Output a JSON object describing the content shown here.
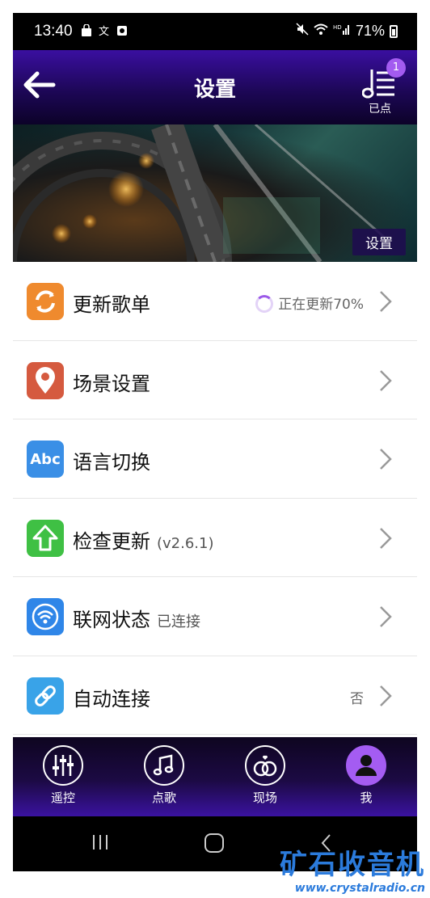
{
  "status_bar": {
    "time": "13:40",
    "battery": "71%"
  },
  "header": {
    "title": "设置",
    "queue_label": "已点",
    "queue_count": "1"
  },
  "banner": {
    "tag": "设置"
  },
  "settings": [
    {
      "label": "更新歌单",
      "sub": "",
      "value": "正在更新70%",
      "icon": "refresh-icon",
      "color": "#ef8a2e"
    },
    {
      "label": "场景设置",
      "sub": "",
      "value": "",
      "icon": "location-pin-icon",
      "color": "#d55a3f"
    },
    {
      "label": "语言切换",
      "sub": "",
      "value": "",
      "icon": "abc-language-icon",
      "color": "#3a8fe6"
    },
    {
      "label": "检查更新",
      "sub": "(v2.6.1)",
      "value": "",
      "icon": "upload-arrow-icon",
      "color": "#3fc044"
    },
    {
      "label": "联网状态",
      "sub": "已连接",
      "value": "",
      "icon": "wifi-icon",
      "color": "#2f86e8"
    },
    {
      "label": "自动连接",
      "sub": "",
      "value": "否",
      "icon": "link-icon",
      "color": "#39a3e8"
    }
  ],
  "nav": [
    {
      "label": "遥控",
      "icon": "equalizer-icon"
    },
    {
      "label": "点歌",
      "icon": "music-note-icon"
    },
    {
      "label": "现场",
      "icon": "rings-heart-icon"
    },
    {
      "label": "我",
      "icon": "user-icon"
    }
  ],
  "watermark": {
    "title": "矿石收音机",
    "url": "www.crystalradio.cn"
  }
}
